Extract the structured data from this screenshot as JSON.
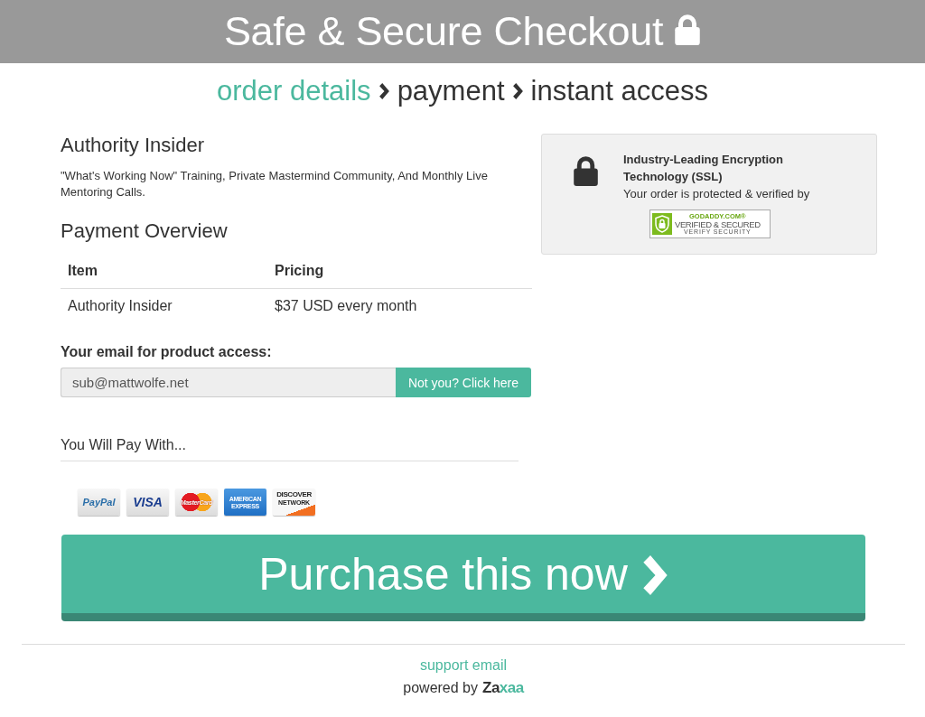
{
  "header": {
    "title": "Safe & Secure Checkout"
  },
  "steps": [
    {
      "label": "order details",
      "selected": true
    },
    {
      "label": "payment",
      "selected": false
    },
    {
      "label": "instant access",
      "selected": false
    }
  ],
  "product": {
    "name": "Authority Insider",
    "description": "\"What's Working Now\" Training, Private Mastermind Community, And Monthly Live Mentoring Calls."
  },
  "overview": {
    "title": "Payment Overview",
    "columns": [
      "Item",
      "Pricing"
    ],
    "rows": [
      [
        "Authority Insider",
        "$37 USD every month"
      ]
    ]
  },
  "email": {
    "label": "Your email for product access:",
    "value": "sub@mattwolfe.net",
    "button": "Not you? Click here"
  },
  "payment": {
    "title": "You Will Pay With...",
    "methods": [
      {
        "kind": "paypal",
        "label": "PayPal"
      },
      {
        "kind": "visa",
        "label": "VISA"
      },
      {
        "kind": "mastercard",
        "label": "MasterCard"
      },
      {
        "kind": "amex",
        "label": "AMERICAN",
        "sublabel": "EXPRESS"
      },
      {
        "kind": "discover",
        "label": "DISCOVER",
        "sublabel": "NETWORK"
      }
    ]
  },
  "purchase_button": {
    "label": "Purchase this now"
  },
  "security": {
    "title": "Industry-Leading Encryption Technology (SSL)",
    "text": "Your order is protected & verified by",
    "seal": {
      "brand": "GODADDY.COM®",
      "title": "VERIFIED & SECURED",
      "subtitle": "VERIFY SECURITY"
    }
  },
  "footer": {
    "link": "support email",
    "powered_by": "powered by",
    "brand_parts": [
      {
        "text": "Za",
        "accent": false
      },
      {
        "text": "xaa",
        "accent": true
      }
    ]
  }
}
